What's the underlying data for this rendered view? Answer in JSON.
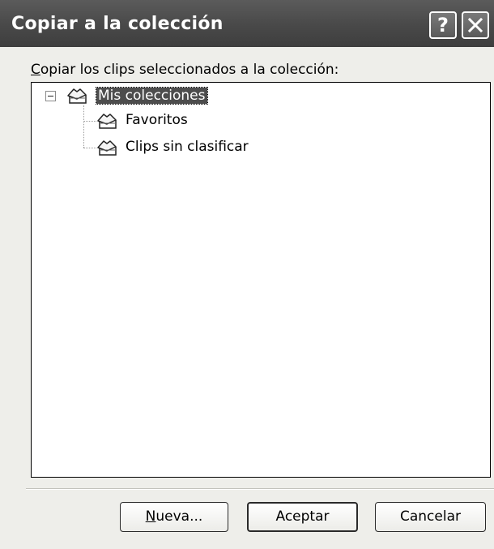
{
  "window": {
    "title": "Copiar a la colección",
    "help_icon": "help-icon",
    "close_icon": "close-icon"
  },
  "prompt": {
    "mnemonic": "C",
    "rest": "opiar los clips seleccionados a la colección:"
  },
  "tree": {
    "root": {
      "label": "Mis colecciones",
      "icon": "collection-folder-icon",
      "expanded": true,
      "selected": true
    },
    "children": [
      {
        "label": "Favoritos",
        "icon": "collection-folder-icon"
      },
      {
        "label": "Clips sin clasificar",
        "icon": "collection-folder-icon"
      }
    ]
  },
  "buttons": {
    "new_mnemonic": "N",
    "new_rest": "ueva...",
    "ok": "Aceptar",
    "cancel": "Cancelar"
  }
}
